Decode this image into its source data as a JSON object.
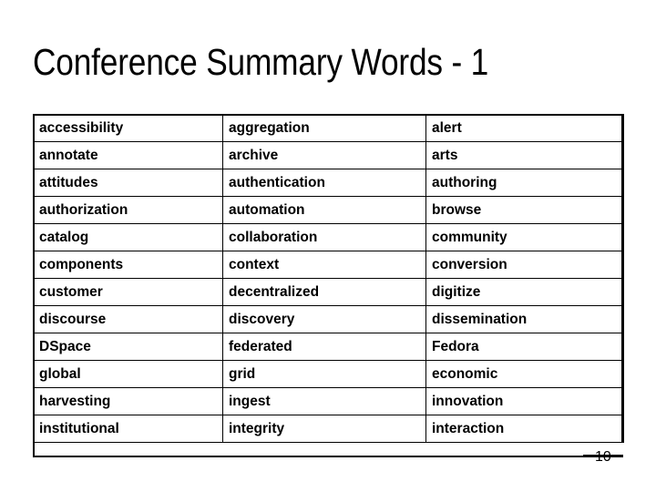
{
  "slide": {
    "title": "Conference Summary Words - 1",
    "page_number": "10",
    "border_color": "#000000",
    "text_color": "#000000",
    "background_color": "#ffffff"
  },
  "table": {
    "columns": 3,
    "rows": [
      [
        "accessibility",
        "aggregation",
        "alert"
      ],
      [
        "annotate",
        "archive",
        "arts"
      ],
      [
        "attitudes",
        "authentication",
        "authoring"
      ],
      [
        "authorization",
        "automation",
        "browse"
      ],
      [
        "catalog",
        "collaboration",
        "community"
      ],
      [
        "components",
        "context",
        "conversion"
      ],
      [
        "customer",
        "decentralized",
        "digitize"
      ],
      [
        "discourse",
        "discovery",
        "dissemination"
      ],
      [
        "DSpace",
        "federated",
        "Fedora"
      ],
      [
        "global",
        "grid",
        "economic"
      ],
      [
        "harvesting",
        "ingest",
        "innovation"
      ],
      [
        "institutional",
        "integrity",
        "interaction"
      ]
    ]
  }
}
